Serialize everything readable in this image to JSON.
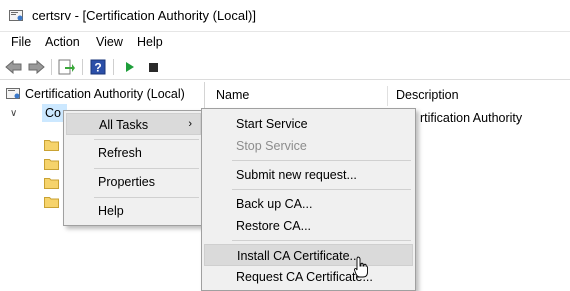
{
  "window": {
    "title": "certsrv - [Certification Authority (Local)]",
    "app_icon": "certsrv-icon"
  },
  "menu": [
    "File",
    "Action",
    "View",
    "Help"
  ],
  "toolbar": {
    "icons": [
      "back-arrow-icon",
      "forward-arrow-icon",
      "export-list-icon",
      "help-icon",
      "start-service-icon",
      "stop-service-icon"
    ]
  },
  "tree": {
    "root": "Certification Authority (Local)",
    "ca_node": "Contoso Subordinate CA",
    "ca_node_visible": "Co"
  },
  "list": {
    "columns": [
      "Name",
      "Description"
    ],
    "rows": [
      {
        "description": "Certification Authority",
        "description_visible": "rtification Authority"
      }
    ]
  },
  "context_menu": {
    "items": [
      {
        "label": "All Tasks",
        "submenu": true,
        "highlighted": true
      },
      {
        "label": "Refresh"
      },
      {
        "label": "Properties"
      },
      {
        "label": "Help"
      }
    ]
  },
  "submenu": {
    "items": [
      {
        "label": "Start Service",
        "enabled": true
      },
      {
        "label": "Stop Service",
        "enabled": false
      },
      {
        "label": "Submit new request...",
        "enabled": true
      },
      {
        "label": "Back up CA...",
        "enabled": true
      },
      {
        "label": "Restore CA...",
        "enabled": true
      },
      {
        "label": "Install CA Certificate...",
        "enabled": true,
        "highlighted": true
      },
      {
        "label": "Request CA Certificate...",
        "enabled": true
      }
    ]
  },
  "colors": {
    "selection": "#cce8ff",
    "menu_bg": "#f0f0f0",
    "menu_highlight": "#dadada",
    "disabled_text": "#8c8c8c",
    "play_green": "#1e9e3a"
  }
}
